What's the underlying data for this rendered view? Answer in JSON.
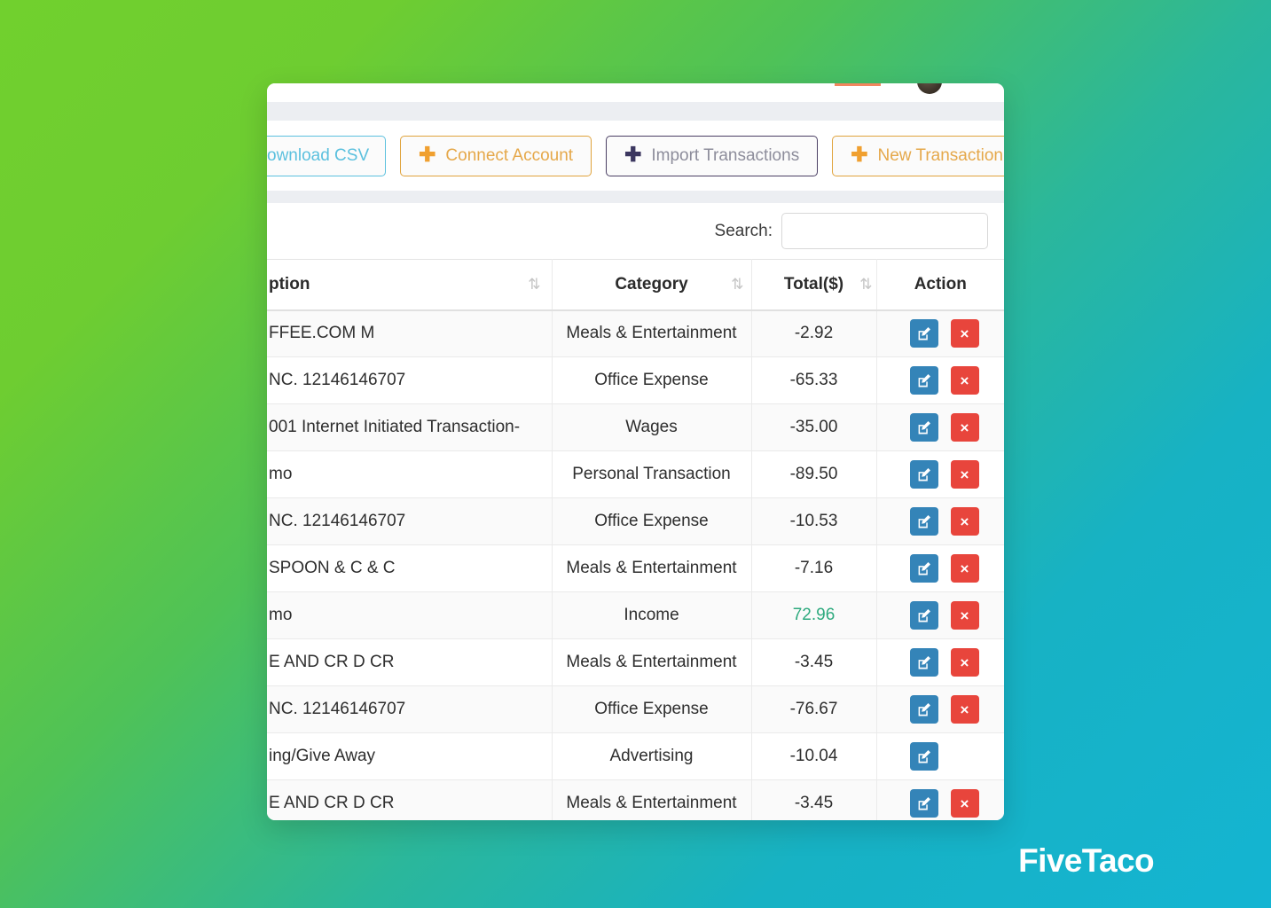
{
  "watermark": {
    "text": "FiveTaco"
  },
  "toolbar": {
    "download_csv_label": "ownload CSV",
    "connect_account_label": "Connect Account",
    "import_transactions_label": "Import Transactions",
    "new_transaction_label": "New Transaction",
    "plus_glyph": "✚",
    "colors": {
      "csv_accent": "#5bc0de",
      "connect_accent": "#e5a84a",
      "import_accent": "#4a3f63",
      "new_accent": "#e5a84a"
    }
  },
  "search": {
    "label": "Search:",
    "value": "",
    "placeholder": ""
  },
  "table": {
    "columns": [
      {
        "label": "ption",
        "sortable": true,
        "sort_glyph": "⇅"
      },
      {
        "label": "Category",
        "sortable": true,
        "sort_glyph": "⇅"
      },
      {
        "label": "Total($)",
        "sortable": true,
        "sort_glyph": "⇅"
      },
      {
        "label": "Action",
        "sortable": false,
        "sort_glyph": ""
      }
    ],
    "action_labels": {
      "edit": "edit-row",
      "delete": "×"
    },
    "positive_color": "#2eaa7e",
    "rows": [
      {
        "description": "FFEE.COM M",
        "category": "Meals & Entertainment",
        "total": "-2.92",
        "positive": false,
        "has_delete": true
      },
      {
        "description": "NC. 12146146707",
        "category": "Office Expense",
        "total": "-65.33",
        "positive": false,
        "has_delete": true
      },
      {
        "description": "001 Internet Initiated Transaction-",
        "category": "Wages",
        "total": "-35.00",
        "positive": false,
        "has_delete": true
      },
      {
        "description": "mo",
        "category": "Personal Transaction",
        "total": "-89.50",
        "positive": false,
        "has_delete": true
      },
      {
        "description": "NC. 12146146707",
        "category": "Office Expense",
        "total": "-10.53",
        "positive": false,
        "has_delete": true
      },
      {
        "description": "SPOON & C & C",
        "category": "Meals & Entertainment",
        "total": "-7.16",
        "positive": false,
        "has_delete": true
      },
      {
        "description": "mo",
        "category": "Income",
        "total": "72.96",
        "positive": true,
        "has_delete": true
      },
      {
        "description": "E AND CR D CR",
        "category": "Meals & Entertainment",
        "total": "-3.45",
        "positive": false,
        "has_delete": true
      },
      {
        "description": "NC. 12146146707",
        "category": "Office Expense",
        "total": "-76.67",
        "positive": false,
        "has_delete": true
      },
      {
        "description": "ing/Give Away",
        "category": "Advertising",
        "total": "-10.04",
        "positive": false,
        "has_delete": false
      },
      {
        "description": "E AND CR D CR",
        "category": "Meals & Entertainment",
        "total": "-3.45",
        "positive": false,
        "has_delete": true
      }
    ]
  }
}
